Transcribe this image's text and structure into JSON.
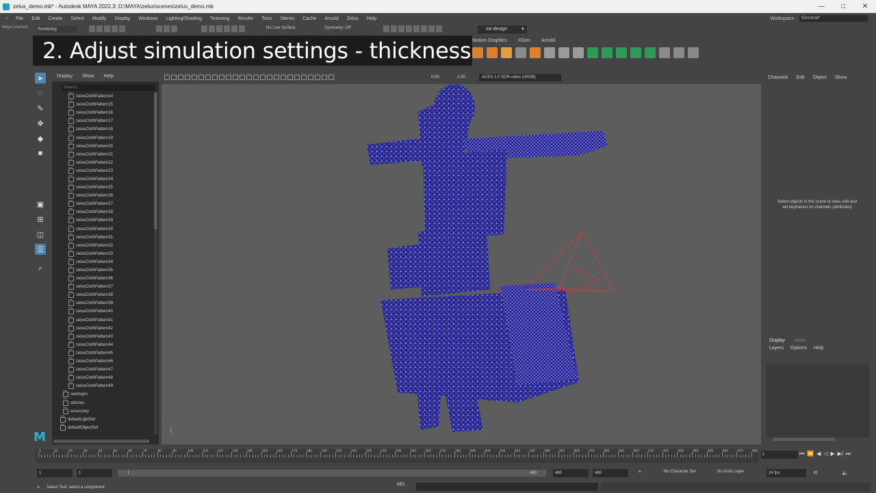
{
  "window": {
    "title": "zelus_demo.mb* - Autodesk MAYA 2022.3: D:\\MAYA\\zelus\\scenes\\zelus_demo.mb",
    "controls": [
      "—",
      "□",
      "✕"
    ]
  },
  "menubar": {
    "items": [
      "File",
      "Edit",
      "Create",
      "Select",
      "Modify",
      "Display",
      "Windows",
      "Lighting/Shading",
      "Texturing",
      "Render",
      "Toon",
      "Stereo",
      "Cache",
      "Arnold",
      "Zelus",
      "Help"
    ],
    "workspace_label": "Workspace :",
    "workspace_value": "General*"
  },
  "statusline": {
    "menuset": "Rendering",
    "crash_note": "Maya crashed",
    "no_live_surface": "No Live Surface",
    "symmetry": "Symmetry: Off",
    "shelf_dropdown": "zw design"
  },
  "shelf": {
    "tabs": [
      "Motion Graphics",
      "XGen",
      "Arnold"
    ]
  },
  "caption": "2. Adjust simulation settings - thickness",
  "outliner": {
    "menu": [
      "Display",
      "Show",
      "Help"
    ],
    "search_placeholder": "Search...",
    "patterns": [
      "zelusClothPattern14",
      "zelusClothPattern15",
      "zelusClothPattern16",
      "zelusClothPattern17",
      "zelusClothPattern18",
      "zelusClothPattern19",
      "zelusClothPattern20",
      "zelusClothPattern21",
      "zelusClothPattern22",
      "zelusClothPattern23",
      "zelusClothPattern24",
      "zelusClothPattern25",
      "zelusClothPattern26",
      "zelusClothPattern27",
      "zelusClothPattern28",
      "zelusClothPattern29",
      "zelusClothPattern30",
      "zelusClothPattern31",
      "zelusClothPattern32",
      "zelusClothPattern33",
      "zelusClothPattern34",
      "zelusClothPattern35",
      "zelusClothPattern36",
      "zelusClothPattern37",
      "zelusClothPattern38",
      "zelusClothPattern39",
      "zelusClothPattern40",
      "zelusClothPattern41",
      "zelusClothPattern42",
      "zelusClothPattern43",
      "zelusClothPattern44",
      "zelusClothPattern45",
      "zelusClothPattern46",
      "zelusClothPattern47",
      "zelusClothPattern48",
      "zelusClothPattern49"
    ],
    "groups": [
      "sewinges",
      "stitches",
      "accessory"
    ],
    "sets": [
      "defaultLightSet",
      "defaultObjectSet"
    ]
  },
  "viewport": {
    "exposure": "0.00",
    "gamma": "1.00",
    "colorspace": "ACES 1.0 SDR-video (sRGB)"
  },
  "channelbox": {
    "menu": [
      "Channels",
      "Edit",
      "Object",
      "Show"
    ],
    "message": "Select objects in the scene to view, edit and set keyframes on channels (attributes)"
  },
  "layers": {
    "tabs": [
      "Display",
      "Anim"
    ],
    "menu": [
      "Layers",
      "Options",
      "Help"
    ]
  },
  "timeline": {
    "ticks": [
      "0",
      "10",
      "20",
      "30",
      "40",
      "50",
      "60",
      "70",
      "80",
      "90",
      "100",
      "110",
      "120",
      "130",
      "140",
      "150",
      "160",
      "170",
      "180",
      "190",
      "200",
      "210",
      "220",
      "230",
      "240",
      "250",
      "260",
      "270",
      "280",
      "290",
      "300",
      "310",
      "320",
      "330",
      "340",
      "350",
      "360",
      "370",
      "380",
      "390",
      "400",
      "410",
      "420",
      "430",
      "440",
      "450",
      "460",
      "470",
      "480"
    ],
    "current_frame": "1"
  },
  "range": {
    "start": "1",
    "start2": "1",
    "bar_start": "1",
    "bar_end": "480",
    "end": "480",
    "end2": "480",
    "character_set": "No Character Set",
    "anim_layer": "No Anim Layer",
    "fps": "24 fps"
  },
  "helpline": {
    "text": "Select Tool: select a component",
    "mel": "MEL"
  },
  "colors": {
    "accent": "#5285a6",
    "mesh": "#1a1a8c",
    "camera": "#d23c3c"
  }
}
